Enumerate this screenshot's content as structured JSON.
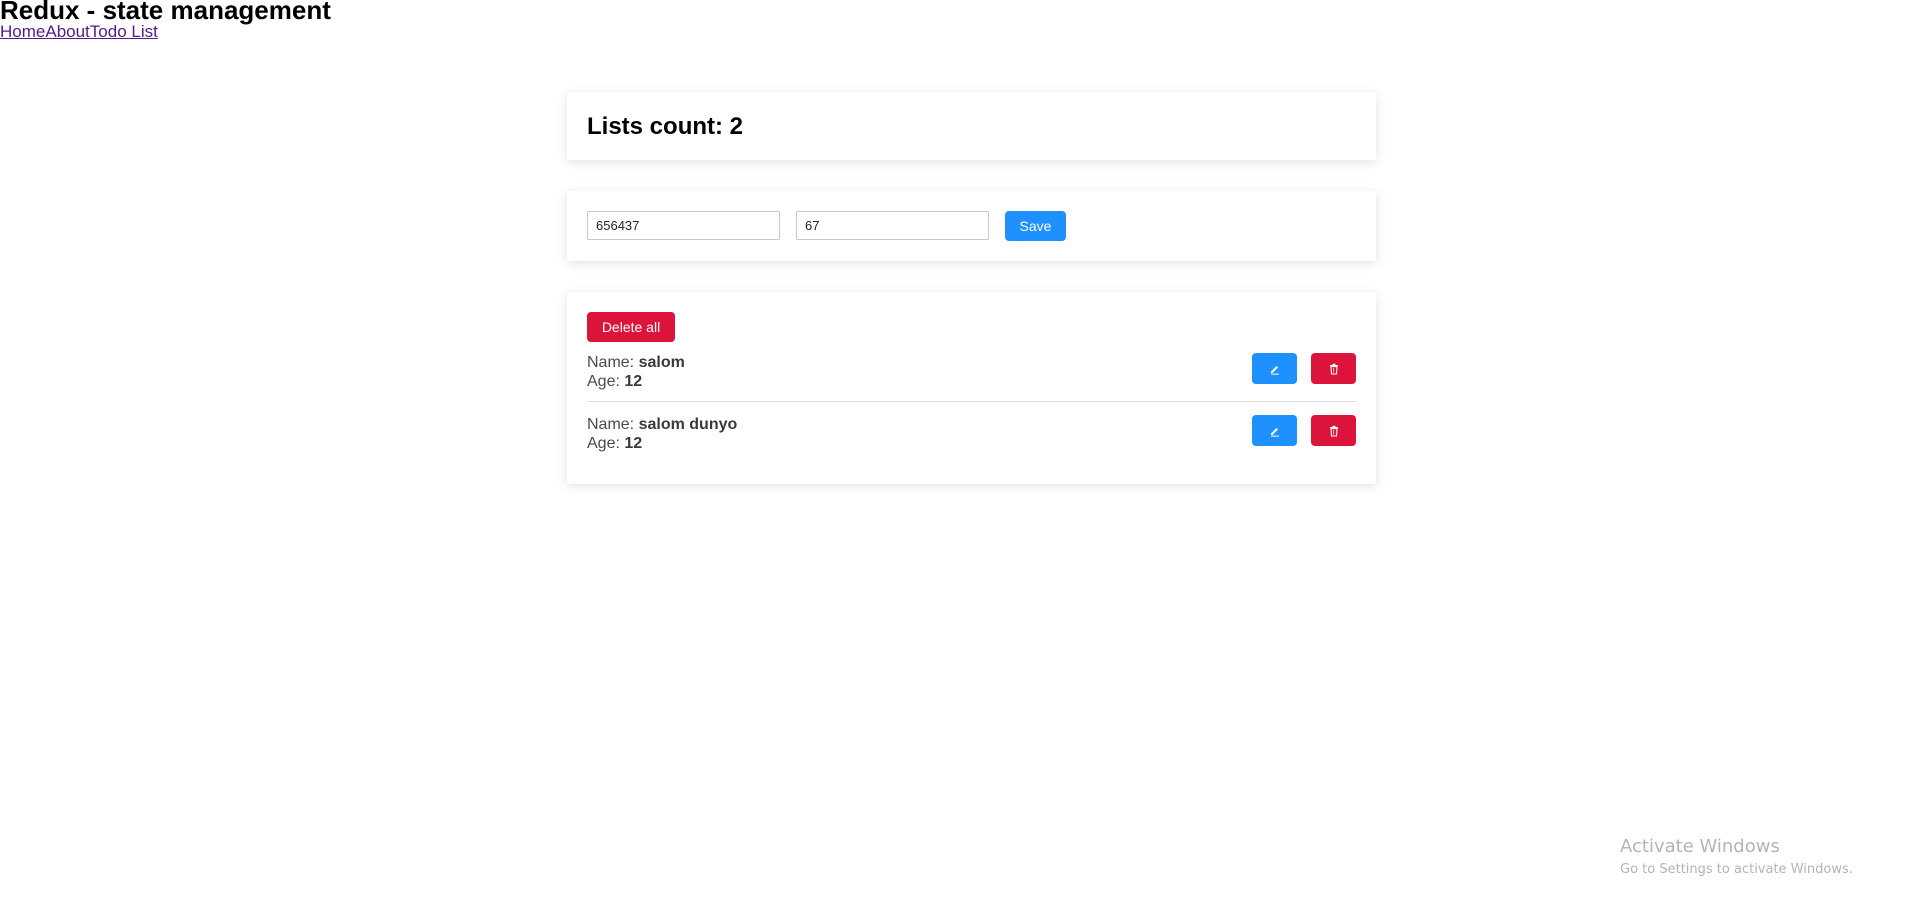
{
  "header": {
    "title": "Redux - state management",
    "nav": [
      "Home",
      "About",
      "Todo List"
    ]
  },
  "count_card": {
    "label": "Lists count: 2"
  },
  "form": {
    "name_value": "656437",
    "age_value": "67",
    "save_label": "Save"
  },
  "list": {
    "delete_all_label": "Delete all",
    "name_label": "Name: ",
    "age_label": "Age: ",
    "items": [
      {
        "name": "salom",
        "age": "12"
      },
      {
        "name": "salom dunyo",
        "age": "12"
      }
    ]
  },
  "watermark": {
    "title": "Activate Windows",
    "subtitle": "Go to Settings to activate Windows."
  },
  "colors": {
    "primary": "#1e90ff",
    "danger": "#dc143c",
    "link": "#551a8b"
  },
  "icons": {
    "edit": "pencil-icon",
    "delete": "trash-icon"
  }
}
